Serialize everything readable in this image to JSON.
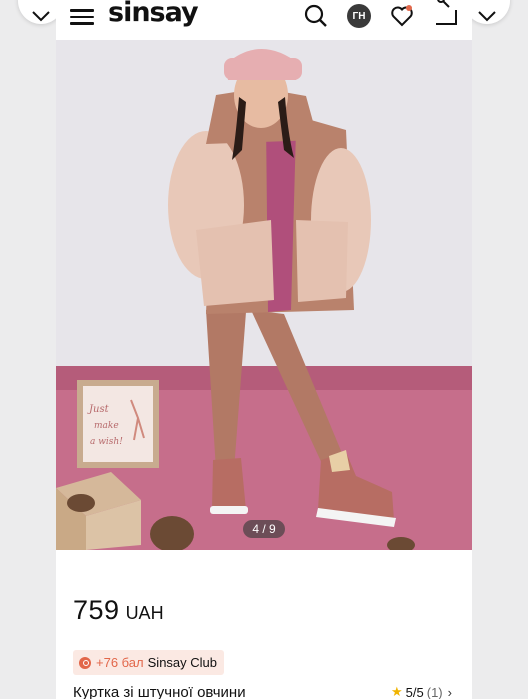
{
  "header": {
    "logo": "sinsay",
    "avatar_initials": "ГН",
    "icons": [
      "menu-icon",
      "search-icon",
      "heart-icon",
      "share-icon",
      "chevron-down-icon",
      "chevron-down-icon"
    ]
  },
  "gallery": {
    "counter": "4 / 9",
    "box_text": "Just make a wish!"
  },
  "product": {
    "price": "759",
    "currency": "UAH",
    "club_points": "+76 бал",
    "club_name": "Sinsay Club",
    "name": "Куртка зі штучної овчини",
    "rating": "5/5",
    "review_count": "(1)"
  },
  "colors": {
    "accent": "#e2674a",
    "background": "#ececed",
    "backdrop_pink": "#c66e8b",
    "star": "#f0b400"
  }
}
